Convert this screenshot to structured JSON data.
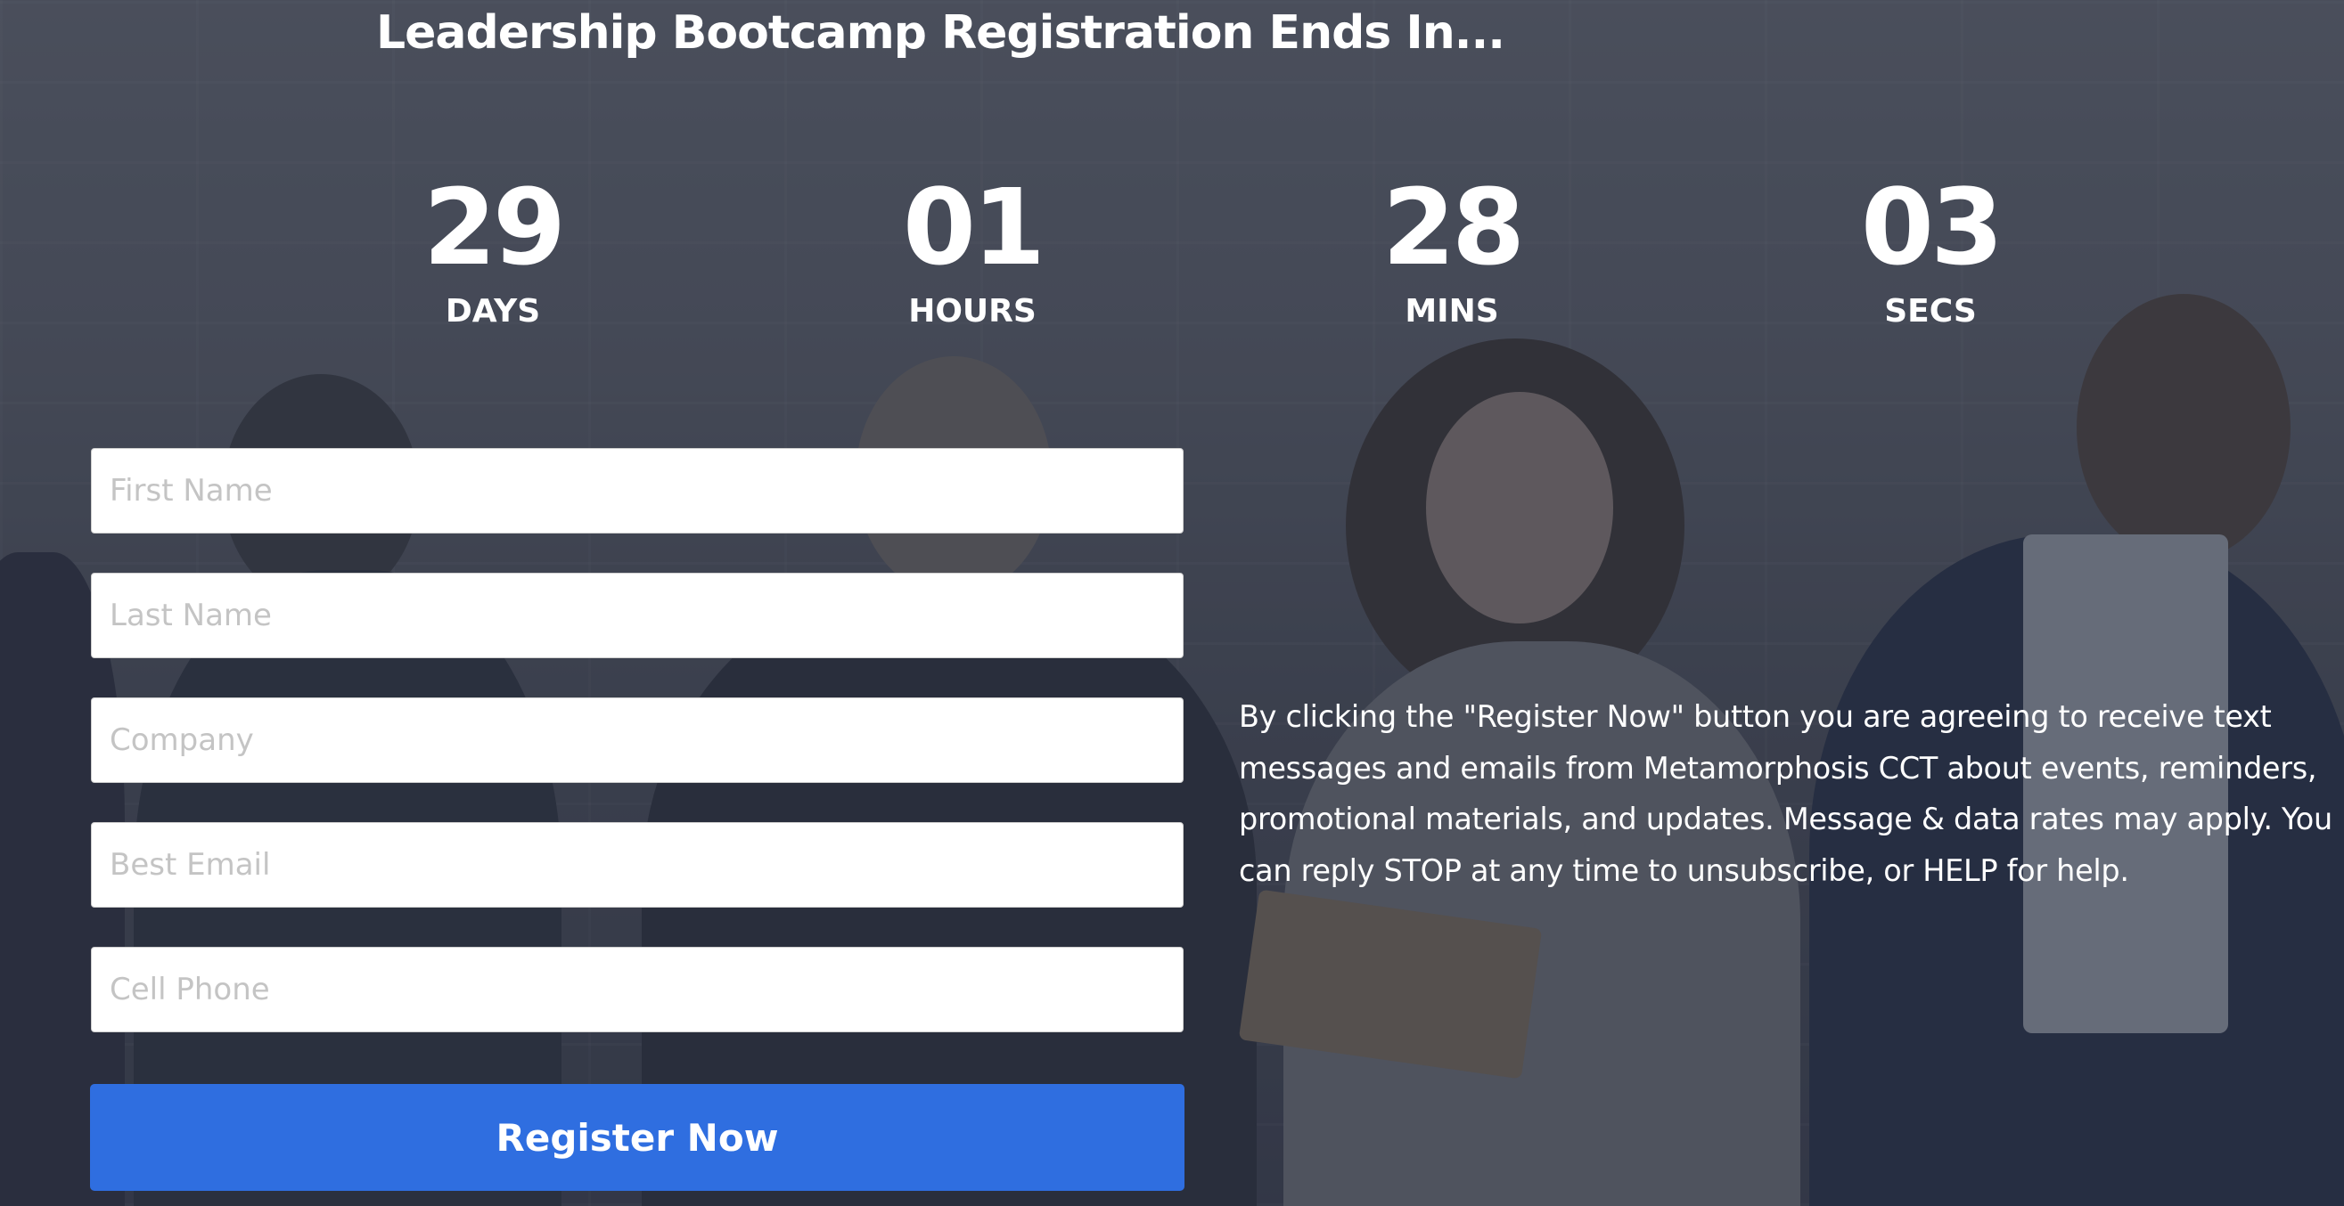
{
  "headline": "Leadership Bootcamp Registration Ends In...",
  "countdown": {
    "days": {
      "value": "29",
      "label": "DAYS"
    },
    "hours": {
      "value": "01",
      "label": "HOURS"
    },
    "mins": {
      "value": "28",
      "label": "MINS"
    },
    "secs": {
      "value": "03",
      "label": "SECS"
    }
  },
  "form": {
    "first_name": {
      "placeholder": "First Name",
      "value": ""
    },
    "last_name": {
      "placeholder": "Last Name",
      "value": ""
    },
    "company": {
      "placeholder": "Company",
      "value": ""
    },
    "email": {
      "placeholder": "Best Email",
      "value": ""
    },
    "phone": {
      "placeholder": "Cell Phone",
      "value": ""
    },
    "submit_label": "Register Now"
  },
  "disclaimer": "By clicking the \"Register Now\" button you are agreeing to receive text messages and emails from Metamorphosis CCT about events, reminders, promotional materials, and updates. Message & data rates may apply. You can reply STOP at any time to unsubscribe, or HELP for help.",
  "colors": {
    "accent": "#2f6ee0",
    "text": "#ffffff",
    "overlay": "#3c4150"
  }
}
